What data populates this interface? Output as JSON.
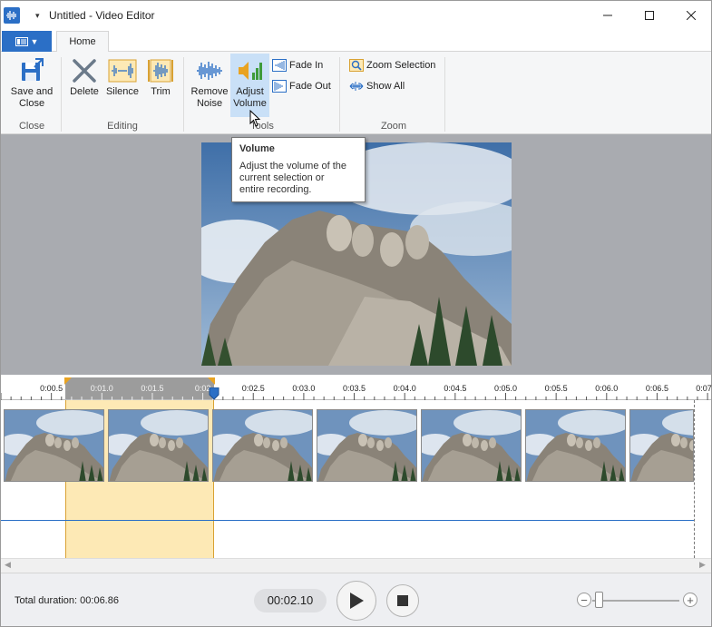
{
  "titlebar": {
    "title": "Untitled - Video Editor",
    "qat_icon": "chevron-down-icon"
  },
  "tabs": {
    "file_icon": "menu-icon",
    "home": "Home"
  },
  "ribbon": {
    "close_group": {
      "label": "Close",
      "save_close_line1": "Save and",
      "save_close_line2": "Close"
    },
    "editing_group": {
      "label": "Editing",
      "delete": "Delete",
      "silence": "Silence",
      "trim": "Trim"
    },
    "tools_group": {
      "label": "Tools",
      "remove_noise_line1": "Remove",
      "remove_noise_line2": "Noise",
      "adjust_volume_line1": "Adjust",
      "adjust_volume_line2": "Volume",
      "fade_in": "Fade In",
      "fade_out": "Fade Out"
    },
    "zoom_group": {
      "label": "Zoom",
      "zoom_selection": "Zoom Selection",
      "show_all": "Show All"
    }
  },
  "tooltip": {
    "title": "Volume",
    "body_line1": "Adjust the volume of the",
    "body_line2": "current selection or",
    "body_line3": "entire recording."
  },
  "timeline": {
    "ticks": [
      "0:00.5",
      "0:01.0",
      "0:01.5",
      "0:02",
      "0:02.5",
      "0:03.0",
      "0:03.5",
      "0:04.0",
      "0:04.5",
      "0:05.0",
      "0:05.5",
      "0:06.0",
      "0:06.5",
      "0:07"
    ],
    "selection_start": "0:00.7",
    "selection_end": "0:02.1",
    "thumbnail_count": 7
  },
  "status": {
    "total_duration": "Total duration: 00:06.86",
    "current_time": "00:02.10",
    "play_icon": "play-icon",
    "stop_icon": "stop-icon",
    "zoom_level": 0.08
  },
  "colors": {
    "accent": "#2b6fc6",
    "selection": "#fde9b5",
    "selection_border": "#d9a233",
    "preview_bg": "#a9abb0"
  }
}
